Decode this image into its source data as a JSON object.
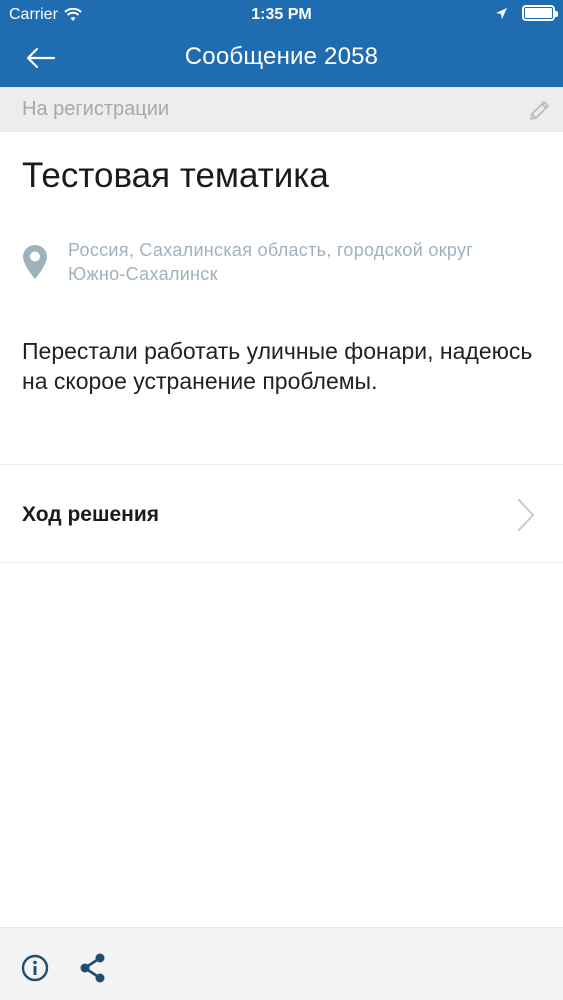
{
  "status_bar": {
    "carrier": "Carrier",
    "time": "1:35 PM"
  },
  "header": {
    "title": "Сообщение 2058",
    "back_icon": "back-arrow-icon"
  },
  "message": {
    "status": "На регистрации",
    "subject": "Тестовая тематика",
    "address": "Россия, Сахалинская область, городской округ Южно-Сахалинск",
    "text": "Перестали работать уличные фонари, надеюсь на скорое устранение проблемы."
  },
  "progress": {
    "label": "Ход решения"
  },
  "colors": {
    "header_bg": "#1f6cb0",
    "accent_dark": "#1f4d6b",
    "address_text": "#9fb2bc",
    "status_band": "#ededed"
  }
}
